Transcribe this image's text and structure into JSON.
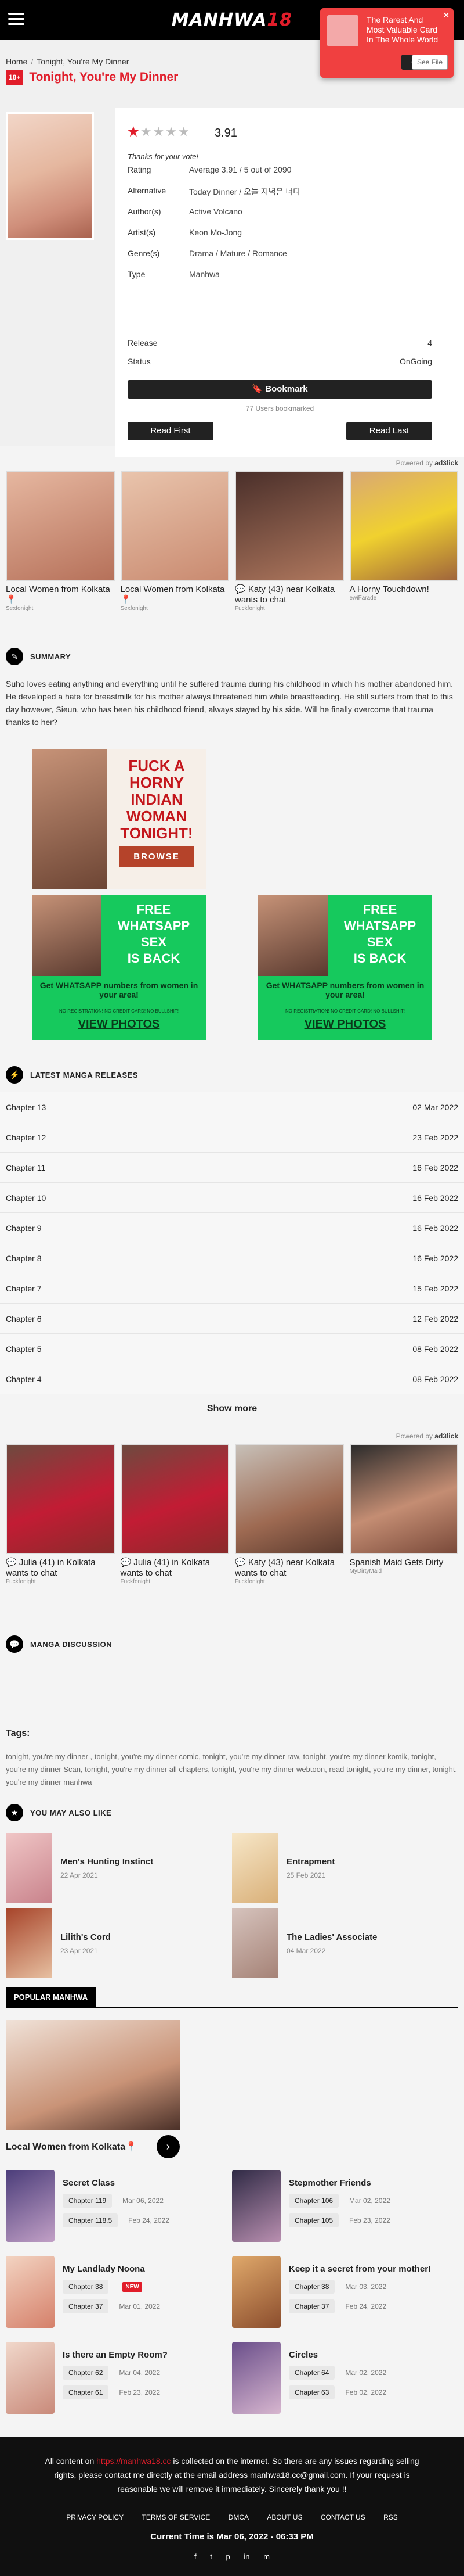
{
  "header": {
    "logo_text": "MANHWA",
    "logo_num": "18"
  },
  "notification": {
    "message": "The Rarest And Most Valuable Card In The Whole World",
    "open_label": "Open",
    "see_label": "See File",
    "close_label": "×"
  },
  "breadcrumb": {
    "home": "Home",
    "current": "Tonight, You're My Dinner",
    "sep": "/"
  },
  "manga": {
    "badge": "18+",
    "title": "Tonight, You're My Dinner",
    "rating_value": "3.91",
    "thanks": "Thanks for your vote!",
    "rating_label": "Rating",
    "rating_text": "Average 3.91 / 5 out of 2090",
    "alternative_label": "Alternative",
    "alternative": "Today Dinner / 오늘 저녁은 너다",
    "authors_label": "Author(s)",
    "authors": "Active Volcano",
    "artists_label": "Artist(s)",
    "artists": "Keon Mo-Jong",
    "genres_label": "Genre(s)",
    "genres": "Drama / Mature / Romance",
    "type_label": "Type",
    "type": "Manhwa",
    "release_label": "Release",
    "release": "4",
    "status_label": "Status",
    "status": "OnGoing",
    "bookmark_label": "Bookmark",
    "bookmark_count": "77 Users bookmarked",
    "read_first": "Read First",
    "read_last": "Read Last"
  },
  "powered": {
    "prefix": "Powered by",
    "brand": "ad3lick"
  },
  "ads_top": [
    {
      "title": "Local Women from Kolkata📍",
      "source": "Sexfonight"
    },
    {
      "title": "Local Women from Kolkata📍",
      "source": "Sexfonight"
    },
    {
      "title": "Katy (43) near Kolkata wants to chat",
      "source": "Fuckfonight"
    },
    {
      "title": "A Horny Touchdown!",
      "source": "ewiFarade"
    }
  ],
  "summary": {
    "heading": "SUMMARY",
    "text": "Suho loves eating anything and everything until he suffered trauma during his childhood in which his mother abandoned him. He developed a hate for breastmilk for his mother always threatened him while breastfeeding. He still suffers from that to this day however, Sieun, who has been his childhood friend, always stayed by his side. Will he finally overcome that trauma thanks to her?"
  },
  "banner": {
    "line1": "FUCK A",
    "line2": "HORNY",
    "line3": "INDIAN",
    "line4": "WOMAN",
    "line5": "TONIGHT!",
    "browse": "BROWSE"
  },
  "whatsapp": {
    "title1": "FREE",
    "title2": "WHATSAPP",
    "title3": "SEX",
    "title4": "IS BACK",
    "sub": "Get WHATSAPP numbers from women in your area!",
    "small": "NO REGISTRATION! NO CREDIT CARD! NO BULLSHIT!",
    "cta": "VIEW PHOTOS"
  },
  "releases": {
    "heading": "LATEST MANGA RELEASES",
    "items": [
      {
        "chapter": "Chapter 13",
        "date": "02 Mar 2022"
      },
      {
        "chapter": "Chapter 12",
        "date": "23 Feb 2022"
      },
      {
        "chapter": "Chapter 11",
        "date": "16 Feb 2022"
      },
      {
        "chapter": "Chapter 10",
        "date": "16 Feb 2022"
      },
      {
        "chapter": "Chapter 9",
        "date": "16 Feb 2022"
      },
      {
        "chapter": "Chapter 8",
        "date": "16 Feb 2022"
      },
      {
        "chapter": "Chapter 7",
        "date": "15 Feb 2022"
      },
      {
        "chapter": "Chapter 6",
        "date": "12 Feb 2022"
      },
      {
        "chapter": "Chapter 5",
        "date": "08 Feb 2022"
      },
      {
        "chapter": "Chapter 4",
        "date": "08 Feb 2022"
      }
    ],
    "show_more": "Show more"
  },
  "ads_mid": [
    {
      "title": "Julia (41) in Kolkata wants to chat",
      "source": "Fuckfonight"
    },
    {
      "title": "Julia (41) in Kolkata wants to chat",
      "source": "Fuckfonight"
    },
    {
      "title": "Katy (43) near Kolkata wants to chat",
      "source": "Fuckfonight"
    },
    {
      "title": "Spanish Maid Gets Dirty",
      "source": "MyDirtyMaid"
    }
  ],
  "discussion": {
    "heading": "MANGA DISCUSSION"
  },
  "tags": {
    "label": "Tags:",
    "text": "tonight, you're my dinner , tonight, you're my dinner comic, tonight, you're my dinner raw, tonight, you're my dinner komik, tonight, you're my dinner Scan, tonight, you're my dinner all chapters, tonight, you're my dinner webtoon, read tonight, you're my dinner, tonight, you're my dinner manhwa"
  },
  "also_like": {
    "heading": "YOU MAY ALSO LIKE",
    "items": [
      {
        "title": "Men's Hunting Instinct",
        "date": "22 Apr 2021"
      },
      {
        "title": "Entrapment",
        "date": "25 Feb 2021"
      },
      {
        "title": "Lilith's Cord",
        "date": "23 Apr 2021"
      },
      {
        "title": "The Ladies' Associate",
        "date": "04 Mar 2022"
      }
    ]
  },
  "popular": {
    "heading": "POPULAR MANHWA",
    "ad_title": "Local Women from Kolkata📍",
    "items": [
      {
        "title": "Secret Class",
        "c1": "Chapter 119",
        "d1": "Mar 06, 2022",
        "c2": "Chapter 118.5",
        "d2": "Feb 24, 2022",
        "new": ""
      },
      {
        "title": "Stepmother Friends",
        "c1": "Chapter 106",
        "d1": "Mar 02, 2022",
        "c2": "Chapter 105",
        "d2": "Feb 23, 2022",
        "new": ""
      },
      {
        "title": "My Landlady Noona",
        "c1": "Chapter 38",
        "d1": "NEW",
        "c2": "Chapter 37",
        "d2": "Mar 01, 2022",
        "new": "NEW"
      },
      {
        "title": "Keep it a secret from your mother!",
        "c1": "Chapter 38",
        "d1": "Mar 03, 2022",
        "c2": "Chapter 37",
        "d2": "Feb 24, 2022",
        "new": ""
      },
      {
        "title": "Is there an Empty Room?",
        "c1": "Chapter 62",
        "d1": "Mar 04, 2022",
        "c2": "Chapter 61",
        "d2": "Feb 23, 2022",
        "new": ""
      },
      {
        "title": "Circles",
        "c1": "Chapter 64",
        "d1": "Mar 02, 2022",
        "c2": "Chapter 63",
        "d2": "Feb 02, 2022",
        "new": ""
      }
    ]
  },
  "footer": {
    "text_before": "All content on ",
    "link": "https://manhwa18.cc",
    "text_after": " is collected on the internet. So there are any issues regarding selling rights, please contact me directly at the email address manhwa18.cc@gmail.com. If your request is reasonable we will remove it immediately. Sincerely thank you !!",
    "links": [
      "PRIVACY POLICY",
      "TERMS OF SERVICE",
      "DMCA",
      "ABOUT US",
      "CONTACT US",
      "RSS"
    ],
    "time": "Current Time is Mar 06, 2022 - 06:33 PM",
    "social": [
      "f",
      "t",
      "p",
      "in",
      "m"
    ]
  }
}
